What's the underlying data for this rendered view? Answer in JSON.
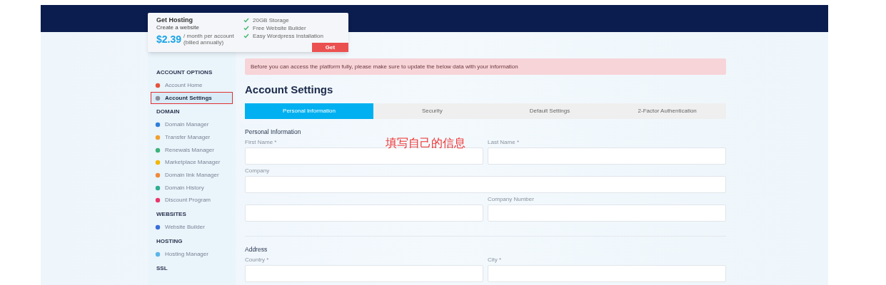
{
  "promo": {
    "title": "Get Hosting",
    "subtitle": "Create a website",
    "price": "$2.39",
    "price_note": [
      "/ month per account",
      "(billed annually)"
    ],
    "features": [
      "20GB Storage",
      "Free Website Builder",
      "Easy Wordpress Installation"
    ],
    "button": "Get"
  },
  "sidebar": {
    "sections": [
      {
        "heading": "ACCOUNT OPTIONS",
        "items": [
          {
            "label": "Account Home",
            "selected": false,
            "marked": false
          },
          {
            "label": "Account Settings",
            "selected": true,
            "marked": true
          }
        ]
      },
      {
        "heading": "DOMAIN",
        "items": [
          {
            "label": "Domain Manager",
            "selected": false,
            "marked": false
          },
          {
            "label": "Transfer Manager",
            "selected": false,
            "marked": false
          },
          {
            "label": "Renewals Manager",
            "selected": false,
            "marked": false
          },
          {
            "label": "Marketplace Manager",
            "selected": false,
            "marked": false
          },
          {
            "label": "Domain link Manager",
            "selected": false,
            "marked": false
          },
          {
            "label": "Domain History",
            "selected": false,
            "marked": false
          },
          {
            "label": "Discount Program",
            "selected": false,
            "marked": false
          }
        ]
      },
      {
        "heading": "WEBSITES",
        "items": [
          {
            "label": "Website Builder",
            "selected": false,
            "marked": false
          }
        ]
      },
      {
        "heading": "HOSTING",
        "items": [
          {
            "label": "Hosting Manager",
            "selected": false,
            "marked": false
          }
        ]
      },
      {
        "heading": "SSL"
      }
    ]
  },
  "alert": "Before you can access the platform fully, please make sure to update the below data with your information",
  "page_title": "Account Settings",
  "tabs": [
    {
      "label": "Personal Information",
      "selected": true
    },
    {
      "label": "Security",
      "selected": false
    },
    {
      "label": "Default Settings",
      "selected": false
    },
    {
      "label": "2-Factor Authentication",
      "selected": false
    }
  ],
  "annotation": "填写自己的信息",
  "form": [
    {
      "title": "Personal Information",
      "rows": [
        [
          {
            "label": "First Name *"
          },
          {
            "label": "Last Name *"
          }
        ],
        [
          {
            "label": "Company"
          }
        ],
        [
          {},
          {
            "label": "Company Number"
          }
        ]
      ]
    },
    {
      "title": "Address",
      "rows": [
        [
          {
            "label": "Country *"
          },
          {
            "label": "City *"
          }
        ]
      ]
    }
  ]
}
